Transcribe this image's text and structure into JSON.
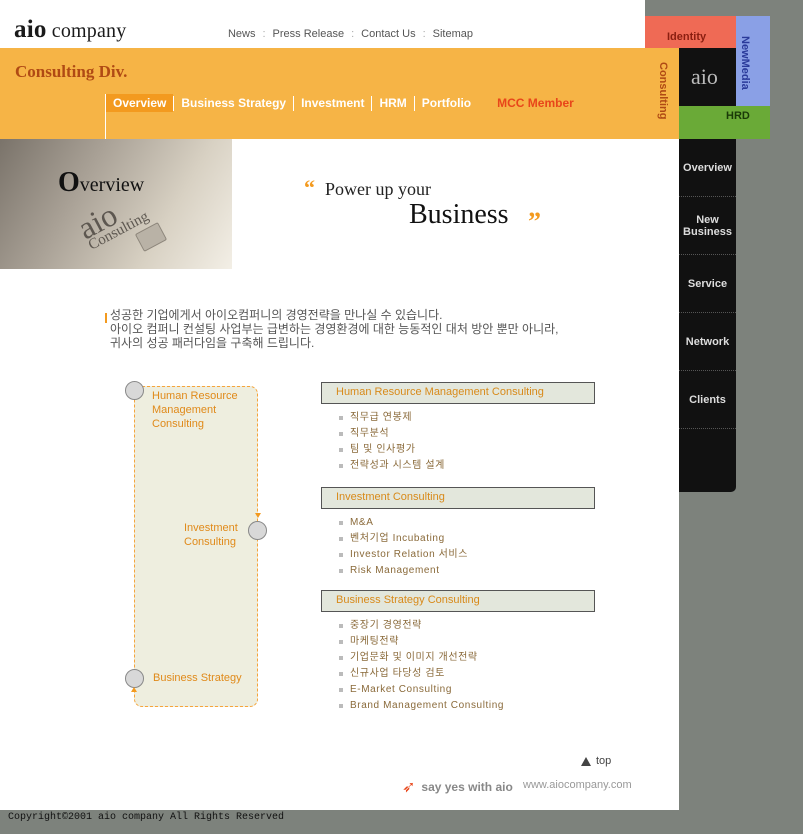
{
  "logo": {
    "brand": "aio",
    "rest": " company"
  },
  "topnav": [
    "News",
    "Press Release",
    "Contact Us",
    "Sitemap"
  ],
  "division_title": "Consulting Div.",
  "mainnav": [
    "Overview",
    "Business Strategy",
    "Investment",
    "HRM",
    "Portfolio"
  ],
  "mcc_member": "MCC Member",
  "tiles": {
    "identity": "Identity",
    "newmedia": "NewMedia",
    "consulting": "Consulting",
    "aio": "aio",
    "hrd": "HRD"
  },
  "sidemenu": [
    "Overview",
    "New Business",
    "Service",
    "Network",
    "Clients"
  ],
  "hero": {
    "overview_first": "O",
    "overview_rest": "verview",
    "aio": "aio",
    "consulting": "Consulting"
  },
  "slogan": {
    "line1": "Power up your",
    "line2": "Business",
    "open_quote": "“",
    "close_quote": "”"
  },
  "intro": [
    "성공한 기업에게서 아이오컴퍼니의 경영전략을 만나실 수 있습니다.",
    "아이오 컴퍼니 컨설팅 사업부는 급변하는 경영환경에 대한 능동적인 대처 방안 뿐만 아니라,",
    "귀사의 성공 패러다임을 구축해 드립니다."
  ],
  "flow": {
    "hr": [
      "Human Resource",
      "Management",
      "Consulting"
    ],
    "inv": [
      "Investment",
      "Consulting"
    ],
    "bs": [
      "Business Strategy"
    ]
  },
  "sections": [
    {
      "title": "Human Resource Management Consulting",
      "items": [
        "직무급 연봉제",
        "직무분석",
        "팀 및 인사평가",
        "전략성과 시스템 설계"
      ]
    },
    {
      "title": "Investment Consulting",
      "items": [
        "M&A",
        "벤처기업 Incubating",
        "Investor Relation 서비스",
        "Risk Management"
      ]
    },
    {
      "title": "Business Strategy Consulting",
      "items": [
        "중장기 경영전략",
        "마케팅전략",
        "기업문화 및 이미지 개선전략",
        "신규사업 타당성 검토",
        "E-Market Consulting",
        "Brand Management Consulting"
      ]
    }
  ],
  "footer": {
    "top": "top",
    "slogan": "say yes with aio",
    "url": "www.aiocompany.com"
  },
  "copyright": "Copyright©2001 aio company All Rights Reserved",
  "colors": {
    "orange": "#f6b446",
    "accent": "#f39a1f",
    "background": "#7d827c"
  }
}
